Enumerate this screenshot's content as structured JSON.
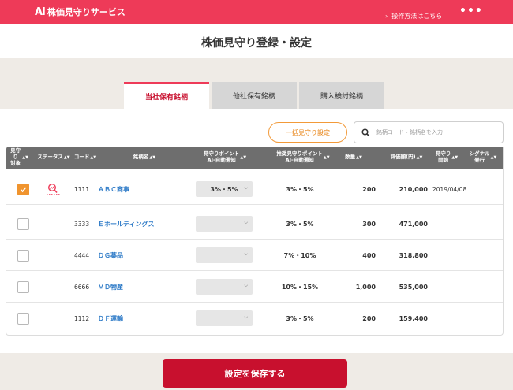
{
  "header": {
    "logo_mark": "AI",
    "app_name": "株価見守りサービス",
    "help_link": "操作方法はこちら",
    "more_glyph": "•••"
  },
  "page_title": "株価見守り登録・設定",
  "tabs": [
    {
      "label": "当社保有銘柄",
      "active": true
    },
    {
      "label": "他社保有銘柄",
      "active": false
    },
    {
      "label": "購入検討銘柄",
      "active": false
    }
  ],
  "toolbar": {
    "bulk_label": "一括見守り設定",
    "search_placeholder": "銘柄コード・銘柄名を入力"
  },
  "table": {
    "headers": {
      "watch": [
        "見守り",
        "対象"
      ],
      "status": "ステータス",
      "code": "コード",
      "name": "銘柄名",
      "point": [
        "見守りポイント",
        "AI-自動通知"
      ],
      "recommend": [
        "推奨見守りポイント",
        "AI-自動通知"
      ],
      "qty": "数量",
      "value": "評価額(円)",
      "start": [
        "見守り",
        "開始"
      ],
      "signal": [
        "シグナル",
        "発行"
      ],
      "sort_glyph": "▲▼"
    },
    "rows": [
      {
        "checked": true,
        "status_icon": "magnifier-chart-icon",
        "code": "1111",
        "name": "ＡＢＣ商事",
        "point": "3%・5%",
        "recommend": "3%・5%",
        "qty": "200",
        "value": "210,000",
        "start": "2019/04/08",
        "signal": ""
      },
      {
        "checked": false,
        "status_icon": "",
        "code": "3333",
        "name": "Ｅホールディングス",
        "point": "",
        "recommend": "3%・5%",
        "qty": "300",
        "value": "471,000",
        "start": "",
        "signal": ""
      },
      {
        "checked": false,
        "status_icon": "",
        "code": "4444",
        "name": "ＤＧ薬品",
        "point": "",
        "recommend": "7%・10%",
        "qty": "400",
        "value": "318,800",
        "start": "",
        "signal": ""
      },
      {
        "checked": false,
        "status_icon": "",
        "code": "6666",
        "name": "ＭＤ物産",
        "point": "",
        "recommend": "10%・15%",
        "qty": "1,000",
        "value": "535,000",
        "start": "",
        "signal": ""
      },
      {
        "checked": false,
        "status_icon": "",
        "code": "1112",
        "name": "ＤＦ運輸",
        "point": "",
        "recommend": "3%・5%",
        "qty": "200",
        "value": "159,400",
        "start": "",
        "signal": ""
      }
    ]
  },
  "save_label": "設定を保存する",
  "colors": {
    "brand": "#ee3a58",
    "accent": "#f0942e",
    "save": "#c8102e",
    "link": "#2a78c6"
  }
}
